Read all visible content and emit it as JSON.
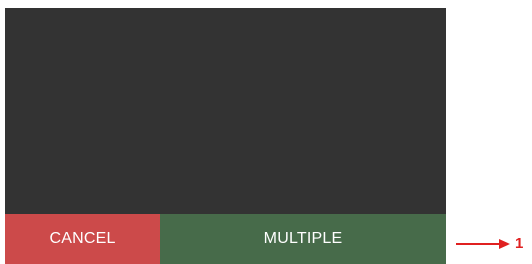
{
  "buttons": {
    "cancel_label": "CANCEL",
    "multiple_label": "MULTIPLE"
  },
  "annotation": {
    "label": "1",
    "color": "#e02020"
  },
  "colors": {
    "screen_bg": "#333333",
    "cancel_bg": "#cc4a4a",
    "multiple_bg": "#476b4a"
  },
  "icons": {
    "callout_arrow": "arrow-right-icon"
  }
}
